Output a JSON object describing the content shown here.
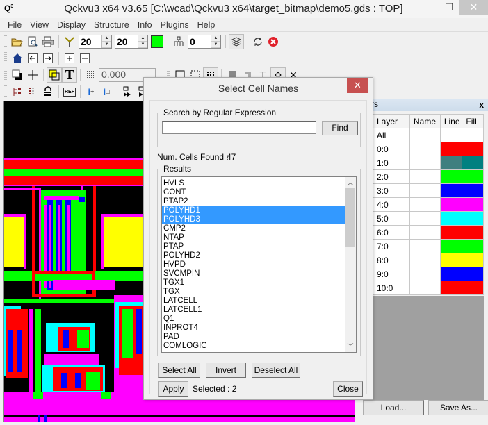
{
  "window": {
    "app_icon": "Q",
    "title": "Qckvu3 x64 v3.65 [C:\\wcad\\Qckvu3 x64\\target_bitmap\\demo5.gds : TOP]",
    "minimize": "–",
    "maximize": "☐",
    "close": "✕"
  },
  "menu": [
    "File",
    "View",
    "Display",
    "Structure",
    "Info",
    "Plugins",
    "Help"
  ],
  "toolbar": {
    "spin1_value": "20",
    "spin2_value": "20",
    "spin3_value": "0",
    "color_swatch": "#00ff00",
    "coord_value": "0.000"
  },
  "layers_panel": {
    "title": "rs",
    "close": "x",
    "columns": [
      "Layer",
      "Name",
      "Line",
      "Fill"
    ],
    "rows": [
      {
        "layer": "All",
        "name": "",
        "line": "",
        "fill": ""
      },
      {
        "layer": "0:0",
        "name": "",
        "line": "#ff0000",
        "fill": "#ff0000"
      },
      {
        "layer": "1:0",
        "name": "",
        "line": "#3f7f7f",
        "fill": "#008080"
      },
      {
        "layer": "2:0",
        "name": "",
        "line": "#00ff00",
        "fill": "#00ff00"
      },
      {
        "layer": "3:0",
        "name": "",
        "line": "#0000ff",
        "fill": "#0000ff"
      },
      {
        "layer": "4:0",
        "name": "",
        "line": "#ff00ff",
        "fill": "#ff00ff"
      },
      {
        "layer": "5:0",
        "name": "",
        "line": "#00ffff",
        "fill": "#00ffff"
      },
      {
        "layer": "6:0",
        "name": "",
        "line": "#ff0000",
        "fill": "#ff0000"
      },
      {
        "layer": "7:0",
        "name": "",
        "line": "#00ff00",
        "fill": "#00ff00"
      },
      {
        "layer": "8:0",
        "name": "",
        "line": "#ffff00",
        "fill": "#ffff00"
      },
      {
        "layer": "9:0",
        "name": "",
        "line": "#0000ff",
        "fill": "#0000ff"
      },
      {
        "layer": "10:0",
        "name": "",
        "line": "#ff0000",
        "fill": "#ff0000"
      }
    ],
    "load_label": "Load...",
    "save_as_label": "Save As..."
  },
  "dialog": {
    "title": "Select Cell Names",
    "close": "✕",
    "search_group_label": "Search by Regular Expression",
    "search_value": "",
    "find_label": "Find",
    "num_found_label": "Num. Cells Found :",
    "num_found_value": "47",
    "results_group_label": "Results",
    "results": [
      {
        "name": "HVLS",
        "selected": false
      },
      {
        "name": "CONT",
        "selected": false
      },
      {
        "name": "PTAP2",
        "selected": false
      },
      {
        "name": "POLYHD1",
        "selected": true
      },
      {
        "name": "POLYHD3",
        "selected": true
      },
      {
        "name": "CMP2",
        "selected": false
      },
      {
        "name": "NTAP",
        "selected": false
      },
      {
        "name": "PTAP",
        "selected": false
      },
      {
        "name": "POLYHD2",
        "selected": false
      },
      {
        "name": "HVPD",
        "selected": false
      },
      {
        "name": "SVCMPIN",
        "selected": false
      },
      {
        "name": "TGX1",
        "selected": false
      },
      {
        "name": "TGX",
        "selected": false
      },
      {
        "name": "LATCELL",
        "selected": false
      },
      {
        "name": "LATCELL1",
        "selected": false
      },
      {
        "name": "Q1",
        "selected": false
      },
      {
        "name": "INPROT4",
        "selected": false
      },
      {
        "name": "PAD",
        "selected": false
      },
      {
        "name": "COMLOGIC",
        "selected": false
      }
    ],
    "select_all_label": "Select All",
    "invert_label": "Invert",
    "deselect_all_label": "Deselect All",
    "apply_label": "Apply",
    "selected_text": "Selected : 2",
    "close_label": "Close"
  }
}
